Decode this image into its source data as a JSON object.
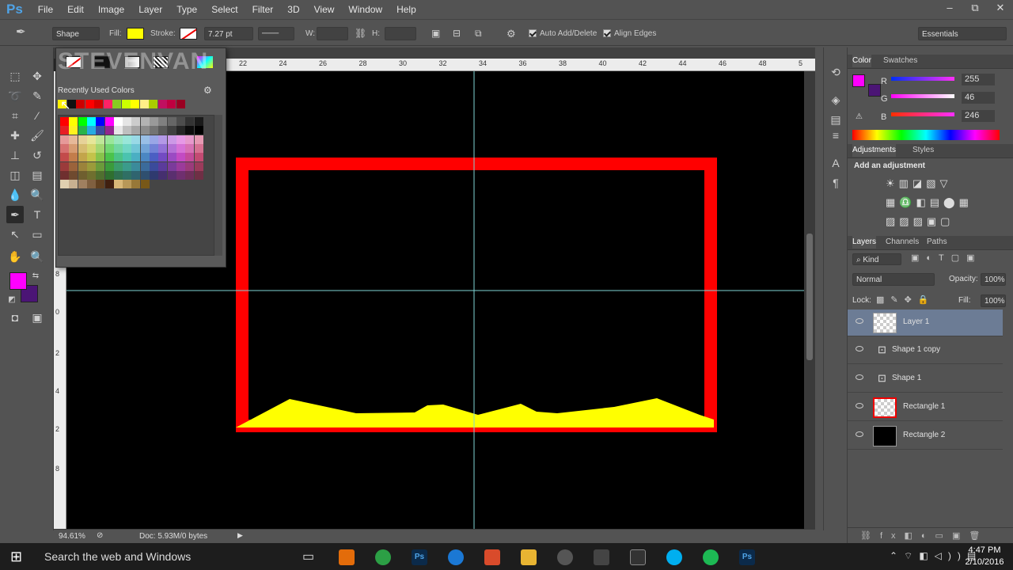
{
  "app": {
    "logo": "Ps",
    "watermark": "STEVENVAN"
  },
  "menu": [
    "File",
    "Edit",
    "Image",
    "Layer",
    "Type",
    "Select",
    "Filter",
    "3D",
    "View",
    "Window",
    "Help"
  ],
  "window_controls": [
    "–",
    "⧉",
    "✕"
  ],
  "options": {
    "mode": "Shape",
    "fill_label": "Fill:",
    "stroke_label": "Stroke:",
    "stroke_width": "7.27 pt",
    "w_label": "W:",
    "h_label": "H:",
    "auto_add_delete": "Auto Add/Delete",
    "align_edges": "Align Edges",
    "workspace": "Essentials",
    "fill_color": "#ffff00"
  },
  "swatch_popup": {
    "title": "Recently Used Colors"
  },
  "ruler": {
    "h_ticks": [
      "22",
      "24",
      "26",
      "28",
      "30",
      "32",
      "34",
      "36",
      "38",
      "40",
      "42",
      "44",
      "46",
      "48",
      "5"
    ],
    "v_ticks": [
      "8",
      "0",
      "2",
      "4",
      "2",
      "8"
    ]
  },
  "status": {
    "zoom": "94.61%",
    "doc": "Doc: 5.93M/0 bytes"
  },
  "colors": {
    "foreground": "#ff00ff",
    "background": "#4b1575",
    "frame": "#ff0000",
    "shape": "#ffff00"
  },
  "color_panel": {
    "tabs": [
      "Color",
      "Swatches"
    ],
    "r_label": "R",
    "r": "255",
    "g_label": "G",
    "g": "46",
    "b_label": "B",
    "b": "246"
  },
  "adjustments": {
    "tabs": [
      "Adjustments",
      "Styles"
    ],
    "title": "Add an adjustment"
  },
  "layers_panel": {
    "tabs": [
      "Layers",
      "Channels",
      "Paths"
    ],
    "filter": "Kind",
    "blend_mode": "Normal",
    "opacity_label": "Opacity:",
    "opacity": "100%",
    "lock_label": "Lock:",
    "fill_label": "Fill:",
    "fill": "100%",
    "layers": [
      {
        "name": "Layer 1"
      },
      {
        "name": "Shape 1 copy"
      },
      {
        "name": "Shape 1"
      },
      {
        "name": "Rectangle 1"
      },
      {
        "name": "Rectangle 2"
      }
    ]
  },
  "taskbar": {
    "search": "Search the web and Windows",
    "time": "4:47 PM",
    "date": "2/10/2016"
  }
}
